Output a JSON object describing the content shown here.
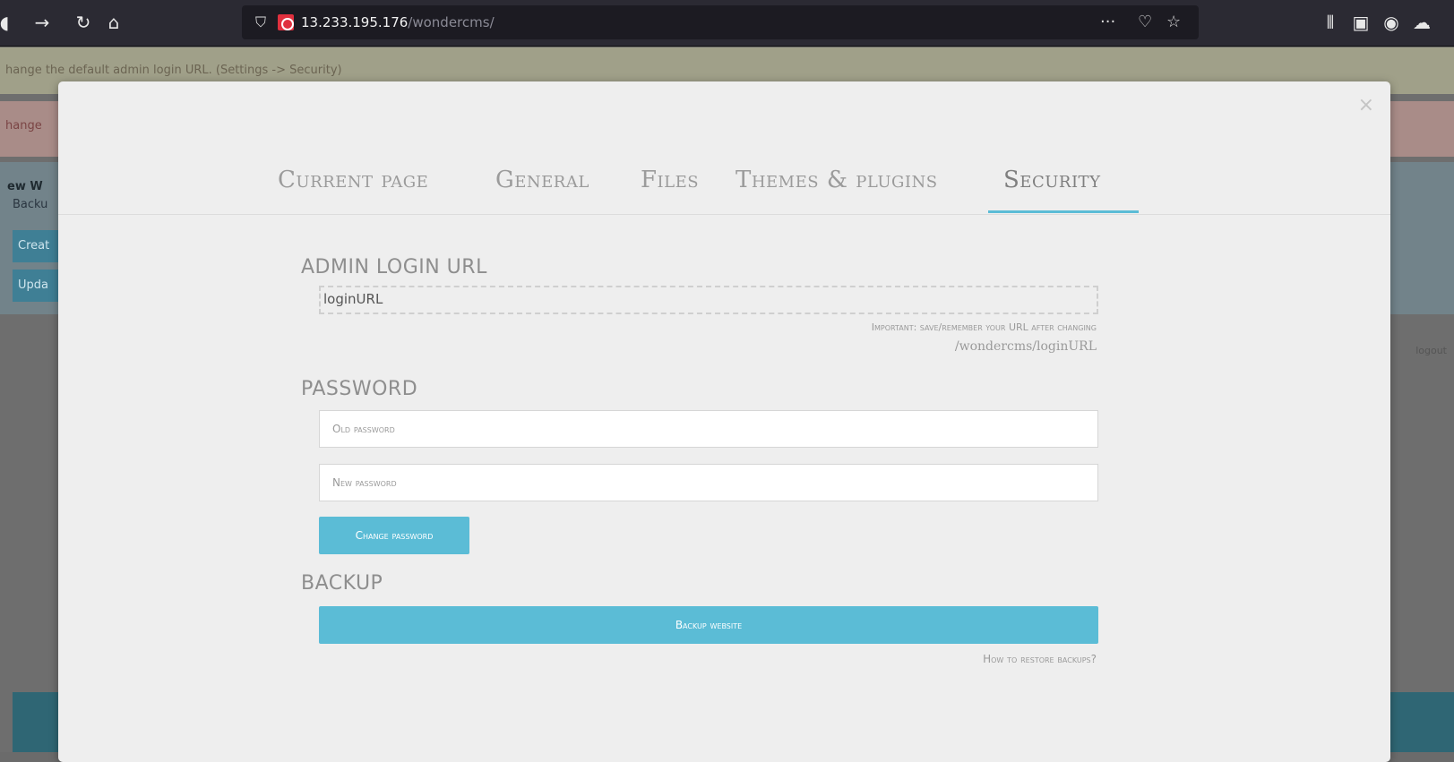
{
  "browser": {
    "url_host": "13.233.195.176",
    "url_path": "/wondercms/",
    "icons": [
      "back-icon",
      "forward-icon",
      "reload-icon",
      "home-icon",
      "shield-icon",
      "insecure-lock-icon",
      "more-icon",
      "pocket-icon",
      "star-icon",
      "library-icon",
      "sidebar-icon",
      "account-icon",
      "extension-icon"
    ]
  },
  "background_page": {
    "notice1": "hange the default admin login URL. (Settings -> Security)",
    "notice2": "hange",
    "panel_title": "ew W",
    "panel_subtitle": "Backu",
    "btn_create": "Creat",
    "btn_update": "Upda",
    "right_text": "logout"
  },
  "modal": {
    "close_label": "×",
    "tabs": [
      {
        "label": "Current page"
      },
      {
        "label": "General"
      },
      {
        "label": "Files"
      },
      {
        "label": "Themes & plugins"
      },
      {
        "label": "Security",
        "active": true
      }
    ],
    "login": {
      "title": "ADMIN LOGIN URL",
      "value": "loginURL",
      "note": "Important: save/remember your URL after changing",
      "path": "/wondercms/loginURL"
    },
    "password": {
      "title": "PASSWORD",
      "old_placeholder": "Old password",
      "new_placeholder": "New password",
      "change_label": "Change password"
    },
    "backup": {
      "title": "BACKUP",
      "backup_label": "Backup website",
      "restore_link": "How to restore backups?"
    }
  },
  "colors": {
    "accent": "#5bbcd6",
    "modal_bg": "#eeeeee",
    "toolbar_bg": "#2b2a33"
  }
}
